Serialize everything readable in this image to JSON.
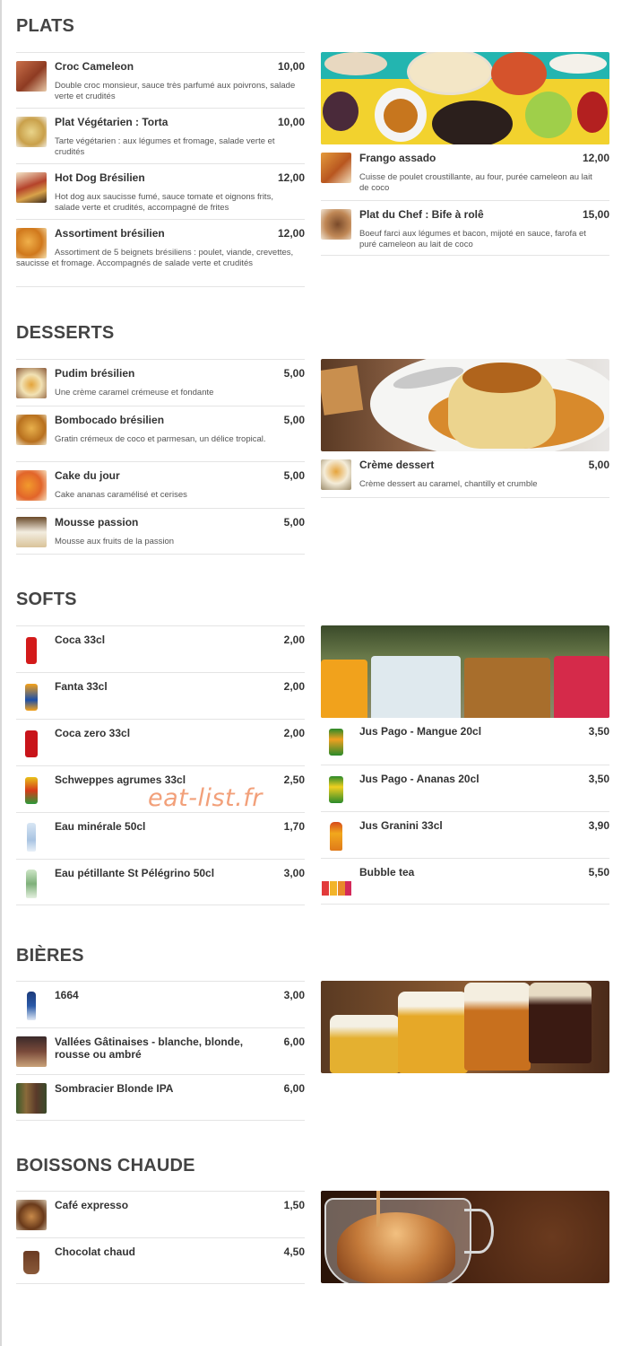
{
  "watermark": "eat-list.fr",
  "sections": {
    "plats": {
      "title": "PLATS",
      "left": [
        {
          "name": "Croc Cameleon",
          "price": "10,00",
          "desc": "Double croc monsieur, sauce très parfumé aux poivrons, salade verte et crudités"
        },
        {
          "name": "Plat Végétarien : Torta",
          "price": "10,00",
          "desc": "Tarte végétarien : aux légumes et fromage, salade verte et crudités"
        },
        {
          "name": "Hot Dog Brésilien",
          "price": "12,00",
          "desc": "Hot dog aux saucisse fumé, sauce tomate et oignons frits, salade verte et crudités, accompagné de frites"
        },
        {
          "name": "Assortiment brésilien",
          "price": "12,00",
          "desc": "Assortiment de 5 beignets brésiliens : poulet, viande, crevettes, saucisse et fromage. Accompagnés de salade verte et crudités"
        }
      ],
      "right": [
        {
          "name": "Frango assado",
          "price": "12,00",
          "desc": "Cuisse de poulet croustillante, au four, purée cameleon au lait de coco"
        },
        {
          "name": "Plat du Chef : Bife à rolê",
          "price": "15,00",
          "desc": "Boeuf farci aux légumes et bacon, mijoté en sauce, farofa et puré cameleon au lait de coco"
        }
      ]
    },
    "desserts": {
      "title": "DESSERTS",
      "left": [
        {
          "name": "Pudim brésilien",
          "price": "5,00",
          "desc": "Une crème caramel crémeuse et fondante"
        },
        {
          "name": "Bombocado brésilien",
          "price": "5,00",
          "desc": "Gratin crémeux de coco et parmesan, un délice tropical."
        },
        {
          "name": "Cake du jour",
          "price": "5,00",
          "desc": "Cake ananas caramélisé et cerises"
        },
        {
          "name": "Mousse passion",
          "price": "5,00",
          "desc": "Mousse aux fruits de la passion"
        }
      ],
      "right": [
        {
          "name": "Crème dessert",
          "price": "5,00",
          "desc": "Crème dessert au caramel, chantilly et crumble"
        }
      ]
    },
    "softs": {
      "title": "SOFTS",
      "left": [
        {
          "name": "Coca 33cl",
          "price": "2,00"
        },
        {
          "name": "Fanta 33cl",
          "price": "2,00"
        },
        {
          "name": "Coca zero 33cl",
          "price": "2,00"
        },
        {
          "name": "Schweppes agrumes 33cl",
          "price": "2,50"
        },
        {
          "name": "Eau minérale 50cl",
          "price": "1,70"
        },
        {
          "name": "Eau pétillante St Pélégrino 50cl",
          "price": "3,00"
        }
      ],
      "right": [
        {
          "name": "Jus Pago - Mangue 20cl",
          "price": "3,50"
        },
        {
          "name": "Jus Pago - Ananas 20cl",
          "price": "3,50"
        },
        {
          "name": "Jus Granini 33cl",
          "price": "3,90"
        },
        {
          "name": "Bubble tea",
          "price": "5,50"
        }
      ]
    },
    "bieres": {
      "title": "BIÈRES",
      "left": [
        {
          "name": "1664",
          "price": "3,00"
        },
        {
          "name": "Vallées Gâtinaises - blanche, blonde, rousse ou ambré",
          "price": "6,00"
        },
        {
          "name": "Sombracier Blonde IPA",
          "price": "6,00"
        }
      ]
    },
    "boissons": {
      "title": "BOISSONS CHAUDE",
      "left": [
        {
          "name": "Café expresso",
          "price": "1,50"
        },
        {
          "name": "Chocolat chaud",
          "price": "4,50"
        }
      ]
    }
  }
}
